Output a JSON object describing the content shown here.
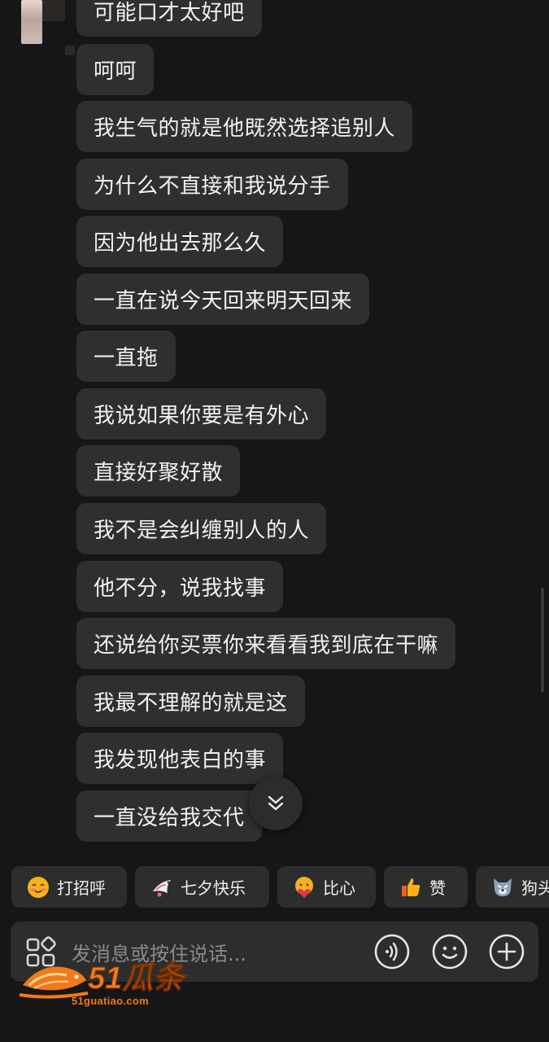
{
  "messages": [
    "可能口才太好吧",
    "呵呵",
    "我生气的就是他既然选择追别人",
    "为什么不直接和我说分手",
    "因为他出去那么久",
    "一直在说今天回来明天回来",
    "一直拖",
    "我说如果你要是有外心",
    "直接好聚好散",
    "我不是会纠缠别人的人",
    "他不分，说我找事",
    "还说给你买票你来看看我到底在干嘛",
    "我最不理解的就是这",
    "我发现他表白的事",
    "一直没给我交代"
  ],
  "quick_replies": [
    {
      "label": "打招呼",
      "icon": "smiling-face-emoji-icon"
    },
    {
      "label": "七夕快乐",
      "icon": "magpie-icon"
    },
    {
      "label": "比心",
      "icon": "heart-hands-emoji-icon"
    },
    {
      "label": "赞",
      "icon": "thumbs-up-icon"
    },
    {
      "label": "狗头",
      "icon": "dog-head-emoji-icon"
    }
  ],
  "input": {
    "placeholder": "发消息或按住说话..."
  },
  "watermark": {
    "logo_text": "51瓜条",
    "domain": "51guatiao.com"
  },
  "colors": {
    "background": "#161616",
    "bubble": "#2f2f2f",
    "watermark": "#f07a1a"
  }
}
